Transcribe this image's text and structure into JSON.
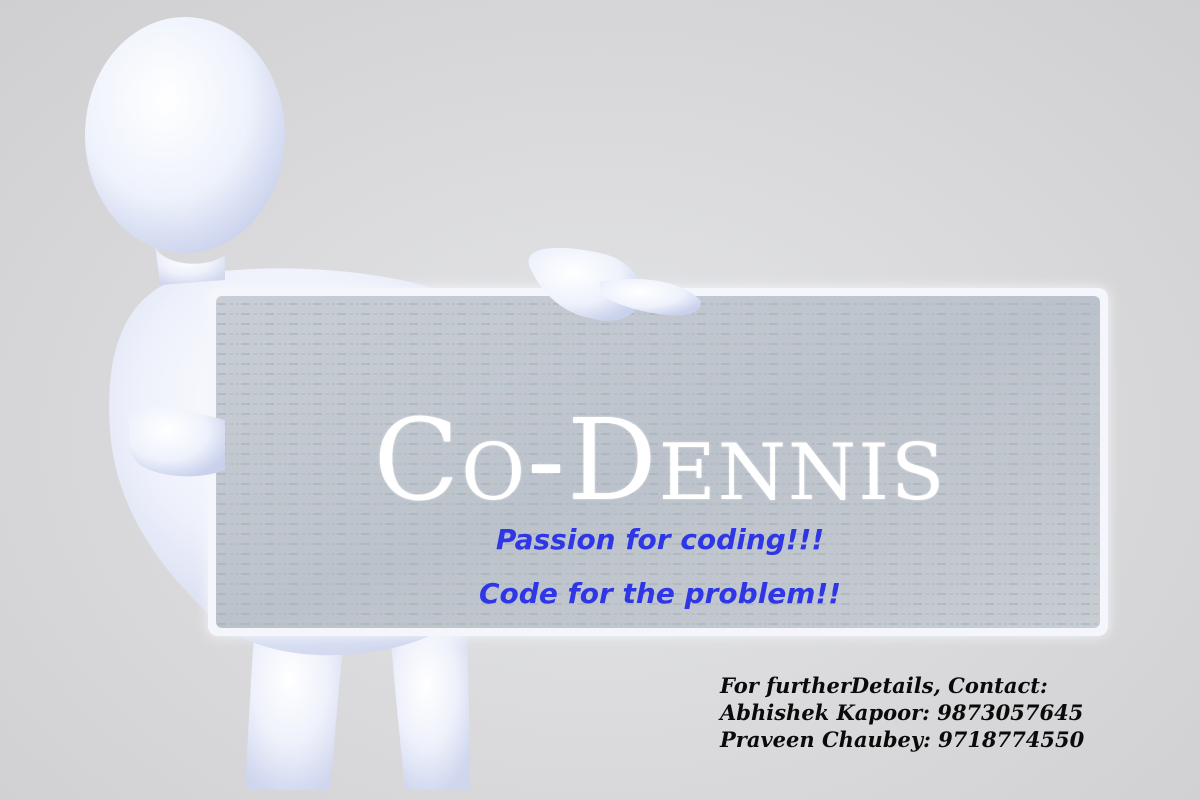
{
  "banner": {
    "title": "Co-Dennis",
    "taglines": [
      "Passion for coding!!!",
      "Code for the problem!!"
    ],
    "contact": {
      "heading": "For furtherDetails, Contact:",
      "people": [
        "Abhishek Kapoor: 9873057645",
        "Praveen Chaubey: 9718774550"
      ]
    }
  },
  "colors": {
    "background": "#d7d7d9",
    "figure": "#eef1fb",
    "tagline": "#2f36e6",
    "contact": "#0a0a0a",
    "title": "#ffffff"
  },
  "icons": [
    "person-figure-icon",
    "code-board-icon"
  ]
}
